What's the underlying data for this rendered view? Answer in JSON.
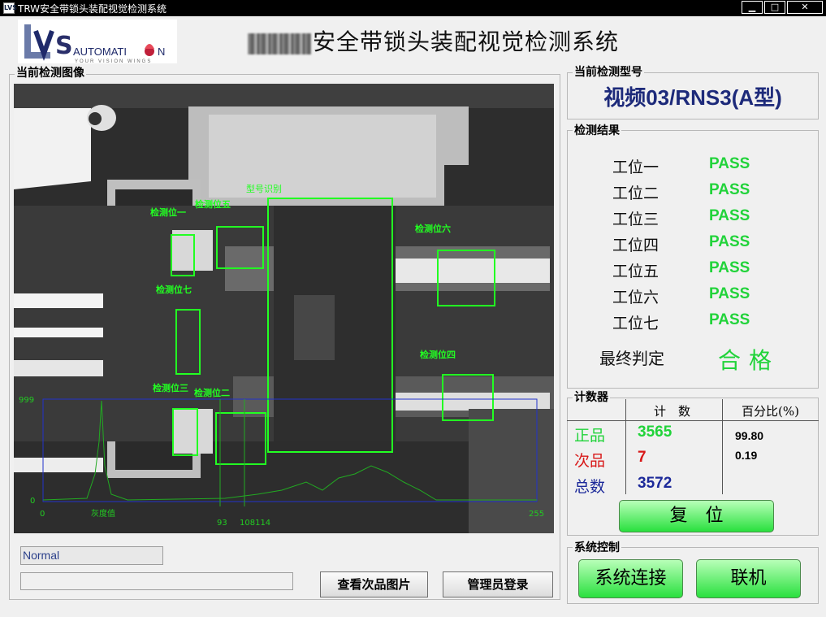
{
  "window": {
    "title": "TRW安全带锁头装配视觉检测系统",
    "app_icon": "LVS",
    "minimize": "▁",
    "maximize": "□",
    "close": "✕"
  },
  "logo": {
    "text": "AUTOMATI",
    "text2": "N",
    "slogan": "YOUR VISION WINGS",
    "letters": "LVS"
  },
  "header": {
    "title_visible": "安全带锁头装配视觉检测系统"
  },
  "image_panel": {
    "label": "当前检测图像",
    "regions": [
      {
        "name": "检测位一",
        "cross": "Y"
      },
      {
        "name": "检测位五",
        "cross": "Y"
      },
      {
        "name": "型号识别",
        "cross": "Y"
      },
      {
        "name": "检测位六",
        "cross": "Y"
      },
      {
        "name": "检测位七",
        "cross": "Y"
      },
      {
        "name": "检测位四",
        "cross": "Y"
      },
      {
        "name": "检测位三",
        "cross": "Y"
      },
      {
        "name": "检测位二",
        "cross": "Y"
      }
    ],
    "histogram": {
      "ymax_label": "999",
      "ymin_label": "0",
      "xmin_label": "0",
      "xmax_label": "255",
      "marker1": "93",
      "marker2": "108114",
      "peak_label": "灰度值"
    }
  },
  "status": {
    "text": "Normal"
  },
  "buttons": {
    "view_defects": "查看次品图片",
    "admin_login": "管理员登录"
  },
  "model_panel": {
    "label": "当前检测型号",
    "value": "视频03/RNS3(A型)"
  },
  "result_panel": {
    "label": "检测结果",
    "rows": [
      {
        "station": "工位一",
        "result": "PASS"
      },
      {
        "station": "工位二",
        "result": "PASS"
      },
      {
        "station": "工位三",
        "result": "PASS"
      },
      {
        "station": "工位四",
        "result": "PASS"
      },
      {
        "station": "工位五",
        "result": "PASS"
      },
      {
        "station": "工位六",
        "result": "PASS"
      },
      {
        "station": "工位七",
        "result": "PASS"
      }
    ],
    "final_label": "最终判定",
    "final_value": "合格",
    "pass_color": "#21d33a"
  },
  "counter_panel": {
    "label": "计数器",
    "col_count": "计　数",
    "col_pct": "百分比(%)",
    "rows": [
      {
        "label": "正品",
        "count": "3565",
        "pct": "99.80",
        "color": "#21d33a"
      },
      {
        "label": "次品",
        "count": "7",
        "pct": "0.19",
        "color": "#d81818"
      },
      {
        "label": "总数",
        "count": "3572",
        "pct": "",
        "color": "#1d2a9a"
      }
    ],
    "reset": "复　位"
  },
  "system_panel": {
    "label": "系统控制",
    "connect": "系统连接",
    "online": "联机"
  }
}
